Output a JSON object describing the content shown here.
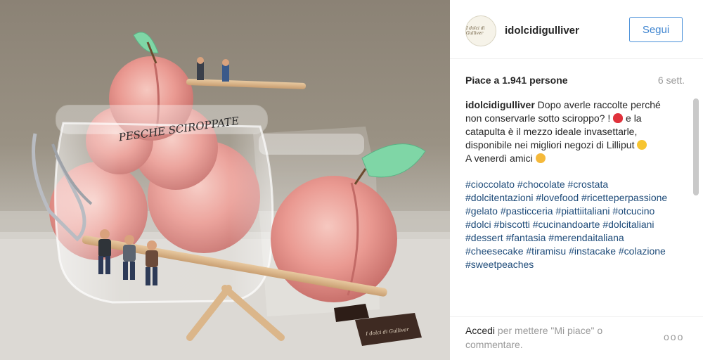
{
  "photo": {
    "jar_label": "PESCHE SCIROPPATE",
    "chocolate_label": "I dolci di Gulliver"
  },
  "header": {
    "avatar_text": "I dolci di Gulliver",
    "username": "idolcidigulliver",
    "follow_label": "Segui"
  },
  "meta": {
    "likes": "Piace a 1.941 persone",
    "time": "6 sett."
  },
  "caption": {
    "author": "idolcidigulliver",
    "line1": " Dopo averle raccolte perché non conservarle sotto sciroppo? !",
    "line2": " e la catapulta è il mezzo ideale invasettarle, disponibile nei migliori negozi di Lilliput ",
    "line3": "A venerdì amici ",
    "hashtags": "#cioccolato #chocolate  #crostata #dolcitentazioni #lovefood #ricetteperpassione  #gelato #pasticceria #piattiitaliani #otcucino #dolci #biscotti #cucinandoarte #dolcitaliani #dessert #fantasia #merendaitaliana #cheesecake #tiramisu #instacake #colazione #sweetpeaches"
  },
  "footer": {
    "login_label": "Accedi",
    "rest": " per mettere \"Mi piace\" o commentare.",
    "more_label": "ooo"
  },
  "colors": {
    "follow_blue": "#3f85d0",
    "hashtag_blue": "#1e4b79",
    "muted_gray": "#999999"
  },
  "icons": [
    "heart-emoji",
    "grin-emoji",
    "hug-emoji",
    "more-options-icon"
  ]
}
